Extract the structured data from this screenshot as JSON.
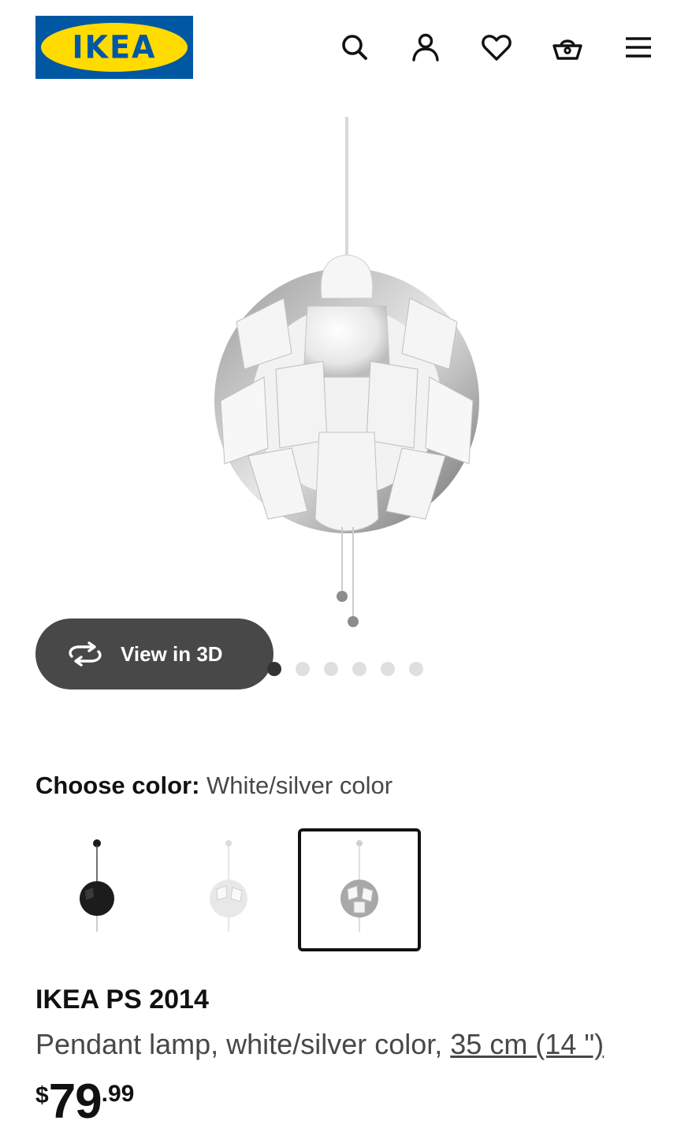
{
  "header": {
    "logo_text": "IKEA",
    "icons": [
      "search-icon",
      "account-icon",
      "heart-icon",
      "basket-icon",
      "menu-icon"
    ]
  },
  "gallery": {
    "view3d_label": "View in 3D",
    "slide_count": 6,
    "active_slide": 1
  },
  "color": {
    "label": "Choose color:",
    "selected_value": "White/silver color",
    "options": [
      "black",
      "white",
      "white/silver"
    ],
    "selected_index": 2
  },
  "product": {
    "name": "IKEA PS 2014",
    "description": "Pendant lamp, white/silver color,",
    "size": "35 cm (14 \")",
    "price_currency": "$",
    "price_int": "79",
    "price_dec": ".99"
  },
  "colors": {
    "brand_blue": "#0058a3",
    "brand_yellow": "#ffdb00",
    "button_dark": "#484848"
  }
}
